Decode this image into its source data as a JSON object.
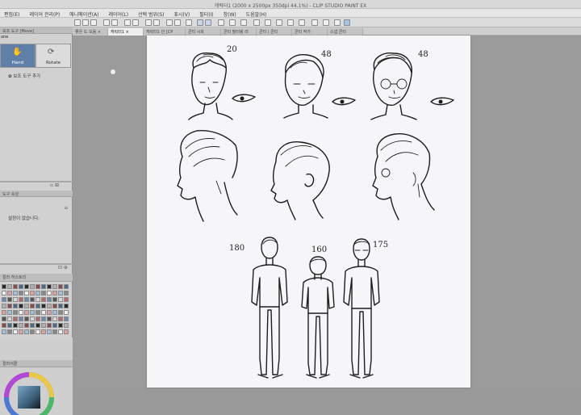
{
  "window": {
    "title": "캐릭터1 (2000 x 2500px 350dpi 44.1%) - CLIP STUDIO PAINT EX"
  },
  "menu": [
    "편집(E)",
    "레이어 관리(P)",
    "애니메이션(A)",
    "레이어(L)",
    "선택 범위(S)",
    "표시(V)",
    "필터(I)",
    "창(W)",
    "도움말(H)"
  ],
  "tabs": [
    "좋은 도 모음 ×",
    "캐릭터1 ×",
    "캐릭터1 안 [CP",
    "콘티 시트",
    "콘티 필터링 리",
    "콘티 | 콘티",
    "콘티 작가",
    "스냅 콘티"
  ],
  "left_panel": {
    "header": "보조 도구 [Move]",
    "sub_label": "one",
    "hand_label": "Hand",
    "rotate_label": "Rotate",
    "add_tool": "보조 도구 추가",
    "nav_header": "도구 속성",
    "nav_msg": "설정이 없습니다.",
    "palette_header": "컬러 히스토리",
    "color_header": "컬러서클"
  },
  "sketch": {
    "ages": [
      "20",
      "48",
      "48"
    ],
    "heights": [
      "180",
      "160",
      "175"
    ]
  },
  "colors": {
    "accent": "#5f7fa9",
    "canvas": "#f6f5f8",
    "workspace": "#9b9b9b"
  }
}
